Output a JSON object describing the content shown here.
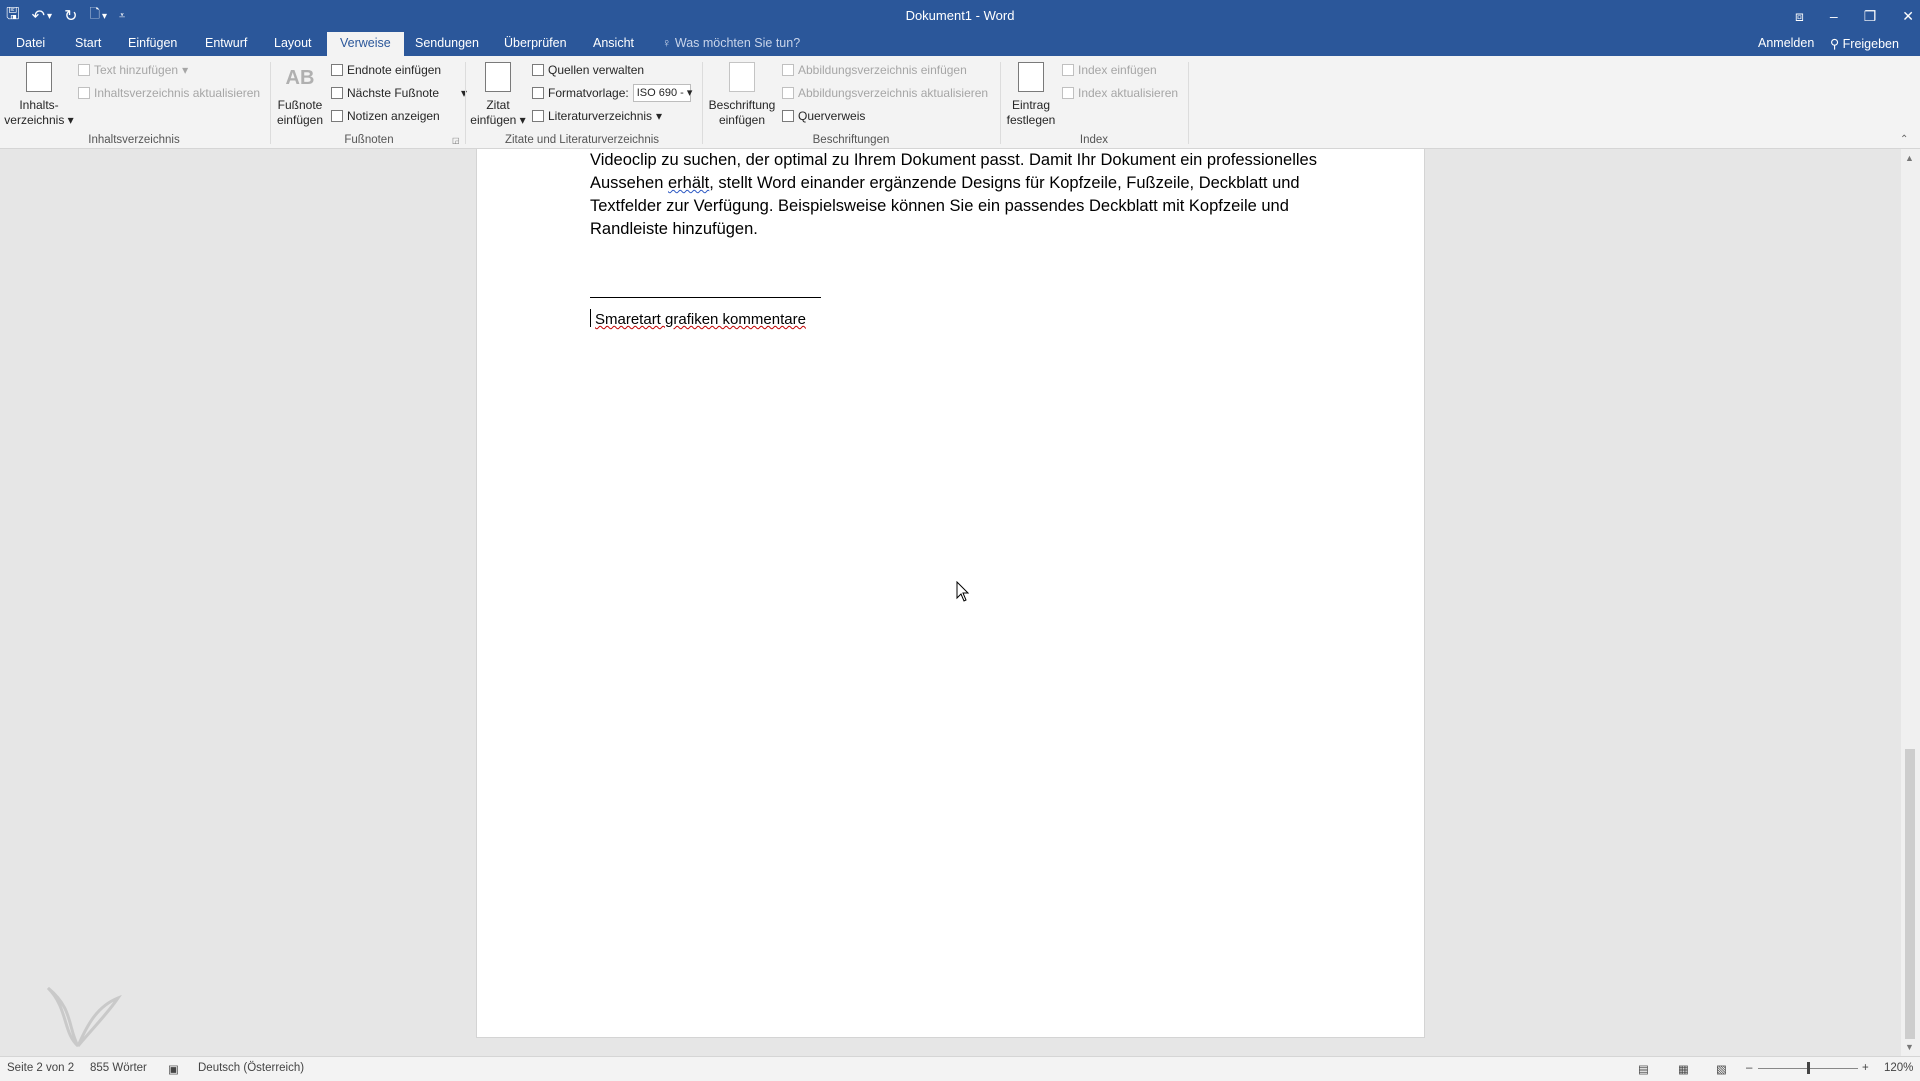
{
  "titlebar": {
    "title": "Dokument1 - Word",
    "qat": {
      "save": "🖫",
      "undo": "↶",
      "undo_dd": "▾",
      "redo": "↻",
      "touch": "🗋",
      "touch_dd": "▾",
      "customize": "⩡"
    },
    "controls": {
      "ribbon_options": "⧈",
      "minimize": "–",
      "restore": "❐",
      "close": "✕"
    }
  },
  "tabs": [
    "Datei",
    "Start",
    "Einfügen",
    "Entwurf",
    "Layout",
    "Verweise",
    "Sendungen",
    "Überprüfen",
    "Ansicht"
  ],
  "tell_me": "Was möchten Sie tun?",
  "account": {
    "signin": "Anmelden",
    "share": "Freigeben"
  },
  "ribbon": {
    "toc": {
      "big_line1": "Inhalts-",
      "big_line2": "verzeichnis",
      "add_text": "Text hinzufügen",
      "update": "Inhaltsverzeichnis aktualisieren",
      "group": "Inhaltsverzeichnis"
    },
    "footnotes": {
      "big_line1": "Fußnote",
      "big_line2": "einfügen",
      "big_glyph": "AB",
      "endnote": "Endnote einfügen",
      "next": "Nächste Fußnote",
      "show": "Notizen anzeigen",
      "group": "Fußnoten"
    },
    "citations": {
      "big_line1": "Zitat",
      "big_line2": "einfügen",
      "manage": "Quellen verwalten",
      "style_label": "Formatvorlage:",
      "style_value": "ISO 690 -",
      "biblio": "Literaturverzeichnis",
      "group": "Zitate und Literaturverzeichnis"
    },
    "captions": {
      "big_line1": "Beschriftung",
      "big_line2": "einfügen",
      "insert_tof": "Abbildungsverzeichnis einfügen",
      "update_tof": "Abbildungsverzeichnis aktualisieren",
      "crossref": "Querverweis",
      "group": "Beschriftungen"
    },
    "index": {
      "big_line1": "Eintrag",
      "big_line2": "festlegen",
      "insert": "Index einfügen",
      "update": "Index aktualisieren",
      "group": "Index"
    }
  },
  "document": {
    "line1": "Videoclip zu suchen, der optimal zu Ihrem Dokument passt. Damit Ihr Dokument ein professionelles",
    "line2_a": "Aussehen ",
    "line2_b": "erhält",
    "line2_c": ", stellt Word einander ergänzende Designs für Kopfzeile, Fußzeile, Deckblatt und",
    "line3": "Textfelder zur Verfügung. Beispielsweise können Sie ein passendes Deckblatt mit Kopfzeile und",
    "line4": "Randleiste hinzufügen.",
    "footnote": "Smaretart grafiken kommentare"
  },
  "status": {
    "page": "Seite 2 von 2",
    "words": "855 Wörter",
    "language": "Deutsch (Österreich)",
    "zoom": "120%",
    "zoom_minus": "–",
    "zoom_plus": "+"
  }
}
